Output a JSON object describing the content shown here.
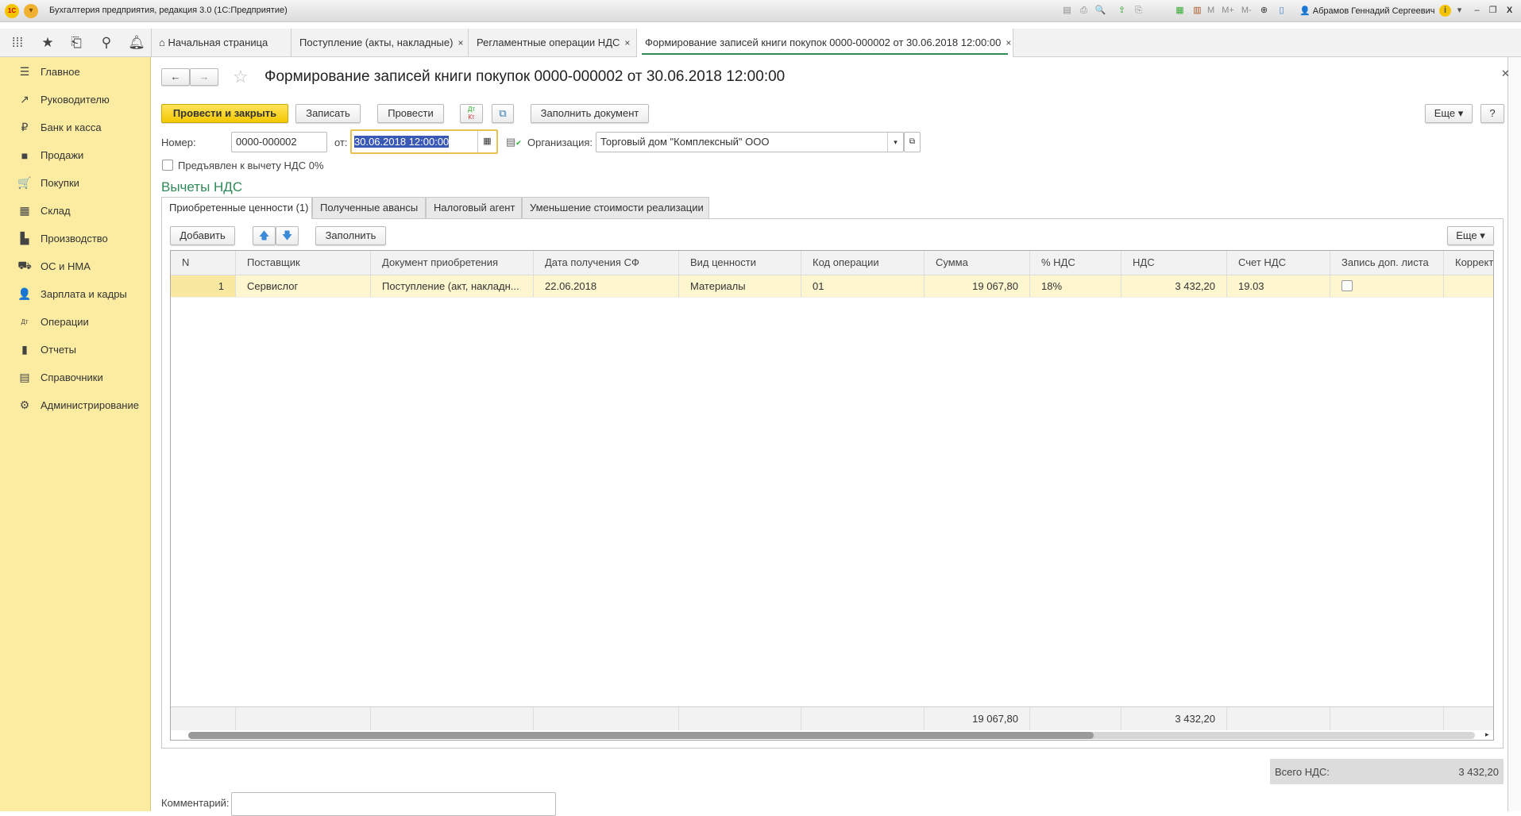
{
  "window": {
    "title": "Бухгалтерия предприятия, редакция 3.0  (1С:Предприятие)",
    "logo": "1С",
    "user": "Абрамов Геннадий Сергеевич",
    "toolbar_labels": [
      "M",
      "M+",
      "M-"
    ]
  },
  "tabs": [
    {
      "label": "Начальная страница",
      "closable": false
    },
    {
      "label": "Поступление (акты, накладные)",
      "closable": true
    },
    {
      "label": "Регламентные операции НДС",
      "closable": true
    },
    {
      "label": "Формирование записей книги покупок 0000-000002 от 30.06.2018 12:00:00",
      "closable": true,
      "active": true
    }
  ],
  "close_glyph": "×",
  "sidebar": {
    "items": [
      {
        "label": "Главное",
        "icon": "menu-icon",
        "glyph": "☰"
      },
      {
        "label": "Руководителю",
        "icon": "trend-icon",
        "glyph": "↗"
      },
      {
        "label": "Банк и касса",
        "icon": "ruble-icon",
        "glyph": "₽"
      },
      {
        "label": "Продажи",
        "icon": "bag-icon",
        "glyph": "■"
      },
      {
        "label": "Покупки",
        "icon": "cart-icon",
        "glyph": "🛒"
      },
      {
        "label": "Склад",
        "icon": "grid-icon",
        "glyph": "▦"
      },
      {
        "label": "Производство",
        "icon": "factory-icon",
        "glyph": "▙"
      },
      {
        "label": "ОС и НМА",
        "icon": "truck-icon",
        "glyph": "⛟"
      },
      {
        "label": "Зарплата и кадры",
        "icon": "person-icon",
        "glyph": "👤"
      },
      {
        "label": "Операции",
        "icon": "dt-kt-icon",
        "glyph": "Дт"
      },
      {
        "label": "Отчеты",
        "icon": "bar-chart-icon",
        "glyph": "▮"
      },
      {
        "label": "Справочники",
        "icon": "books-icon",
        "glyph": "▤"
      },
      {
        "label": "Администрирование",
        "icon": "gear-icon",
        "glyph": "⚙"
      }
    ]
  },
  "form": {
    "title": "Формирование записей книги покупок 0000-000002 от 30.06.2018 12:00:00",
    "buttons": {
      "post_close": "Провести и закрыть",
      "save": "Записать",
      "post": "Провести",
      "dtkt": "Дт Кт",
      "fill_doc": "Заполнить документ",
      "more": "Еще",
      "help": "?"
    },
    "number_label": "Номер:",
    "number": "0000-000002",
    "date_label": "от:",
    "date": "30.06.2018 12:00:00",
    "org_label": "Организация:",
    "org": "Торговый дом \"Комплексный\" ООО",
    "checkbox_label": "Предъявлен к вычету НДС 0%",
    "checkbox_checked": false,
    "section_title": "Вычеты НДС",
    "inner_tabs": [
      "Приобретенные ценности (1)",
      "Полученные авансы",
      "Налоговый агент",
      "Уменьшение стоимости реализации"
    ],
    "inner_buttons": {
      "add": "Добавить",
      "fill": "Заполнить",
      "more": "Еще"
    },
    "table": {
      "columns": [
        "N",
        "Поставщик",
        "Документ приобретения",
        "Дата получения СФ",
        "Вид ценности",
        "Код операции",
        "Сумма",
        "% НДС",
        "НДС",
        "Счет НДС",
        "Запись доп. листа",
        "Коррект"
      ],
      "rows": [
        [
          "1",
          "Сервислог",
          "Поступление (акт, накладн...",
          "22.06.2018",
          "Материалы",
          "01",
          "19 067,80",
          "18%",
          "3 432,20",
          "19.03",
          false,
          ""
        ]
      ],
      "footer": [
        "",
        "",
        "",
        "",
        "",
        "",
        "19 067,80",
        "",
        "3 432,20",
        "",
        "",
        ""
      ]
    },
    "total_label": "Всего НДС:",
    "total": "3 432,20",
    "comment_label": "Комментарий:",
    "comment": ""
  },
  "colors": {
    "sidebar": "#fbeca1",
    "primary_button": "#f3c800",
    "section_title": "#2e8b57",
    "selected_row": "#fdf6cf",
    "date_focus": "#e8c250"
  }
}
